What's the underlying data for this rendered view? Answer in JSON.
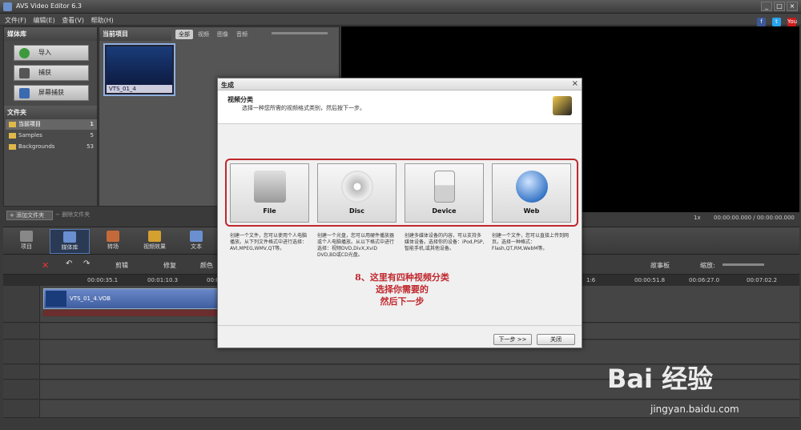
{
  "window": {
    "title": "AVS Video Editor 6.3"
  },
  "menu": [
    "文件(F)",
    "编辑(E)",
    "查看(V)",
    "帮助(H)"
  ],
  "social": [
    {
      "label": "f",
      "color": "#3b5998"
    },
    {
      "label": "t",
      "color": "#2aa3ef"
    },
    {
      "label": "You",
      "color": "#cc1e1e"
    }
  ],
  "left_panel": {
    "title": "媒体库",
    "buttons": [
      {
        "label": "导入",
        "color": "#3c9a3c"
      },
      {
        "label": "捕获",
        "color": "#555"
      },
      {
        "label": "屏幕捕获",
        "color": "#3a6ab0"
      }
    ],
    "folders_title": "文件夹",
    "folders": [
      {
        "name": "当前项目",
        "count": "1"
      },
      {
        "name": "Samples",
        "count": "5"
      },
      {
        "name": "Backgrounds",
        "count": "53"
      }
    ],
    "add_folder": "添加文件夹",
    "delete_folder": "删除文件夹"
  },
  "project": {
    "title": "当前项目",
    "tabs": [
      "全部",
      "视频",
      "图像",
      "音频"
    ],
    "clip_name": "VTS_01_4"
  },
  "preview": {
    "zoom": "1x",
    "time": "00:00:00.000 / 00:00:00.000"
  },
  "toolbar": {
    "buttons": [
      {
        "label": "项目",
        "color": "#888"
      },
      {
        "label": "媒体库",
        "color": "#6a8fd0"
      },
      {
        "label": "转场",
        "color": "#c46a3a"
      },
      {
        "label": "视频效果",
        "color": "#d4a030"
      },
      {
        "label": "文本",
        "color": "#6a90d0"
      }
    ]
  },
  "timeline": {
    "tools": [
      "剪辑",
      "修复",
      "颜色"
    ],
    "storyboard": "故事板",
    "zoom_label": "缩放:",
    "ruler": [
      "00:00:35.1",
      "00:01:10.3",
      "00:01:",
      "1:6",
      "00:00:51.8",
      "00:06:27.0",
      "00:07:02.2"
    ],
    "clip_label": "VTS_01_4.VOB"
  },
  "dialog": {
    "title": "生成",
    "header_title": "视频分类",
    "header_sub": "选择一种您所需的视频格式类别，然后按下一步。",
    "options": [
      {
        "label": "File",
        "desc": "创建一个文件，您可以使用个人电脑播放。从下列文件格式中进行选择：AVI,MPEG,WMV,QT等。"
      },
      {
        "label": "Disc",
        "desc": "创建一个光盘，您可以用硬件播放器或个人电脑播放。从以下格式中进行选择：视频DVD,DivX,XviD DVD,BD或CD光盘。"
      },
      {
        "label": "Device",
        "desc": "创建多媒体设备的内容，可以支持多媒体设备。选择你的设备：iPod,PSP,智能手机,或其他设备。"
      },
      {
        "label": "Web",
        "desc": "创建一个文件，您可以直接上传到网页。选择一种格式：Flash,QT,RM,WebM等。"
      }
    ],
    "annotation": [
      "8、这里有四种视频分类",
      "选择你需要的",
      "然后下一步"
    ],
    "next": "下一步 >>",
    "close": "关闭"
  },
  "watermark": {
    "brand": "Bai 经验",
    "url": "jingyan.baidu.com"
  }
}
